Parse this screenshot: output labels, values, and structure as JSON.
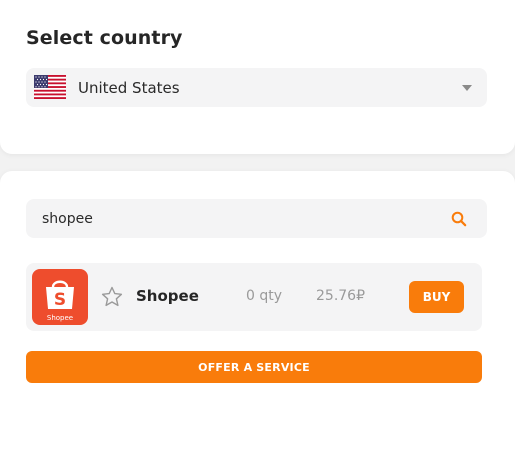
{
  "country_section": {
    "title": "Select country",
    "selected_country": "United States",
    "flag_icon": "us-flag-icon"
  },
  "search": {
    "value": "shopee",
    "icon": "search-icon"
  },
  "services": [
    {
      "name": "Shopee",
      "logo_text": "Shopee",
      "logo_letter": "S",
      "qty": "0 qty",
      "price": "25.76₽",
      "buy_label": "BUY"
    }
  ],
  "offer_button_label": "OFFER A SERVICE",
  "colors": {
    "accent": "#f97c0b",
    "shopee_brand": "#ee4d2d",
    "field_background": "#f4f4f5",
    "page_background": "#f2f2f2"
  }
}
